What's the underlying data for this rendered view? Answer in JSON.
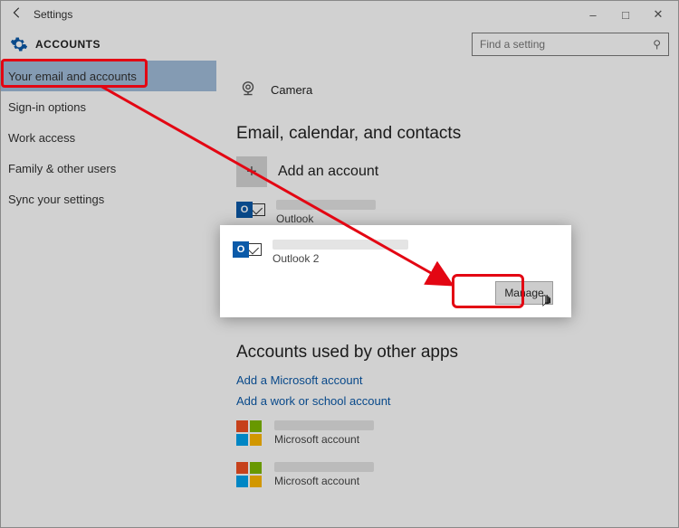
{
  "window": {
    "title": "Settings",
    "header_label": "ACCOUNTS",
    "search_placeholder": "Find a setting"
  },
  "sidebar": {
    "items": [
      {
        "label": "Your email and accounts",
        "active": true
      },
      {
        "label": "Sign-in options"
      },
      {
        "label": "Work access"
      },
      {
        "label": "Family & other users"
      },
      {
        "label": "Sync your settings"
      }
    ]
  },
  "content": {
    "camera_label": "Camera",
    "section_email_title": "Email, calendar, and contacts",
    "add_account_label": "Add an account",
    "accounts": [
      {
        "service": "Outlook"
      },
      {
        "service": "Outlook 2"
      }
    ],
    "manage_label": "Manage",
    "section_other_apps_title": "Accounts used by other apps",
    "link_add_ms": "Add a Microsoft account",
    "link_add_work": "Add a work or school account",
    "ms_accounts": [
      {
        "service": "Microsoft account"
      },
      {
        "service": "Microsoft account"
      }
    ]
  }
}
